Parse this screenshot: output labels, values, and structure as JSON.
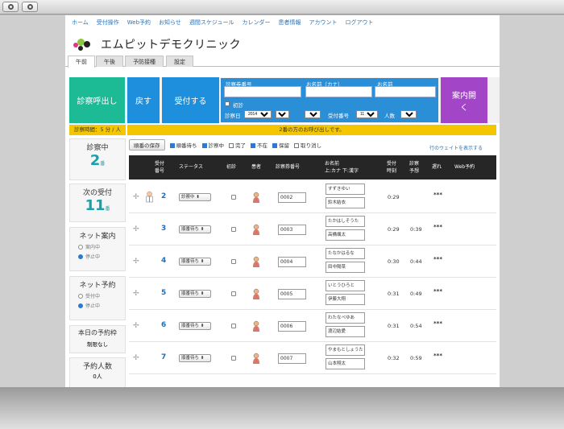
{
  "nav": [
    "ホーム",
    "受付操作",
    "Web予約",
    "お知らせ",
    "週間スケジュール",
    "カレンダー",
    "患者情報",
    "アカウント",
    "ログアウト"
  ],
  "clinic_name": "エムピットデモクリニック",
  "tabs": [
    "午前",
    "午後",
    "予防接種",
    "設定"
  ],
  "actions": {
    "call": "診察呼出し",
    "back": "戻す",
    "accept": "受付する",
    "close": "案内開く"
  },
  "search": {
    "ticket_label": "診察券番号",
    "kana_label": "お名前（カナ）",
    "name_label": "お名前",
    "first_visit": "初診",
    "date_label": "診察日",
    "year": "2014",
    "month": "5月",
    "day": "22",
    "accept_no_label": "受付番号",
    "accept_no": "11番",
    "people_label": "人数",
    "people": "1人"
  },
  "info": {
    "left": "診察時間：5 分 / 人",
    "right": "2番の方のお呼び出しです。"
  },
  "side": {
    "in_exam_title": "診察中",
    "in_exam_num": "2",
    "next_title": "次の受付",
    "next_num": "11",
    "unit": "番",
    "net_guide_title": "ネット案内",
    "net_guide_opts": [
      "案内中",
      "停止中"
    ],
    "net_reserve_title": "ネット予約",
    "net_reserve_opts": [
      "受付中",
      "停止中"
    ],
    "today_title": "本日の予約枠",
    "today_value": "制限なし",
    "count_title": "予約人数",
    "count_value": "0人"
  },
  "filter": {
    "save": "順番の保存",
    "opts": [
      "順番待ち",
      "診察中",
      "完了",
      "不在",
      "保留",
      "取り消し"
    ],
    "weight_link": "行のウェイトを表示する"
  },
  "table": {
    "headers": {
      "accept": "受付\n番号",
      "status": "ステータス",
      "first": "初診",
      "patient": "患者",
      "ticket": "診察券番号",
      "name": "お名前\n上:カナ 下:漢字",
      "time": "受付\n時刻",
      "predict": "診察\n予想",
      "late": "遅れ",
      "web": "Web予約"
    },
    "rows": [
      {
        "num": "2",
        "status": "診察中",
        "ticket": "0002",
        "kana": "すずきゆい",
        "kanji": "鈴木結衣",
        "time": "0:29",
        "predict": "",
        "dots": "***"
      },
      {
        "num": "3",
        "status": "順番待ち",
        "ticket": "0003",
        "kana": "たかはしそうた",
        "kanji": "高橋颯太",
        "time": "0:29",
        "predict": "0:39",
        "dots": "***"
      },
      {
        "num": "4",
        "status": "順番待ち",
        "ticket": "0004",
        "kana": "たなかはるな",
        "kanji": "田中陽菜",
        "time": "0:30",
        "predict": "0:44",
        "dots": "***"
      },
      {
        "num": "5",
        "status": "順番待ち",
        "ticket": "0005",
        "kana": "いとうひろと",
        "kanji": "伊藤大翔",
        "time": "0:31",
        "predict": "0:49",
        "dots": "***"
      },
      {
        "num": "6",
        "status": "順番待ち",
        "ticket": "0006",
        "kana": "わたなべゆあ",
        "kanji": "渡辺結愛",
        "time": "0:31",
        "predict": "0:54",
        "dots": "***"
      },
      {
        "num": "7",
        "status": "順番待ち",
        "ticket": "0007",
        "kana": "やまもとしょうた",
        "kanji": "山本翔太",
        "time": "0:32",
        "predict": "0:59",
        "dots": "***"
      }
    ]
  },
  "colors": {
    "green": "#1dbb95",
    "blue": "#1e8fdc",
    "purple": "#a245c7",
    "yellow": "#f3c600",
    "header": "#262626",
    "accent": "#1aa0a8"
  }
}
